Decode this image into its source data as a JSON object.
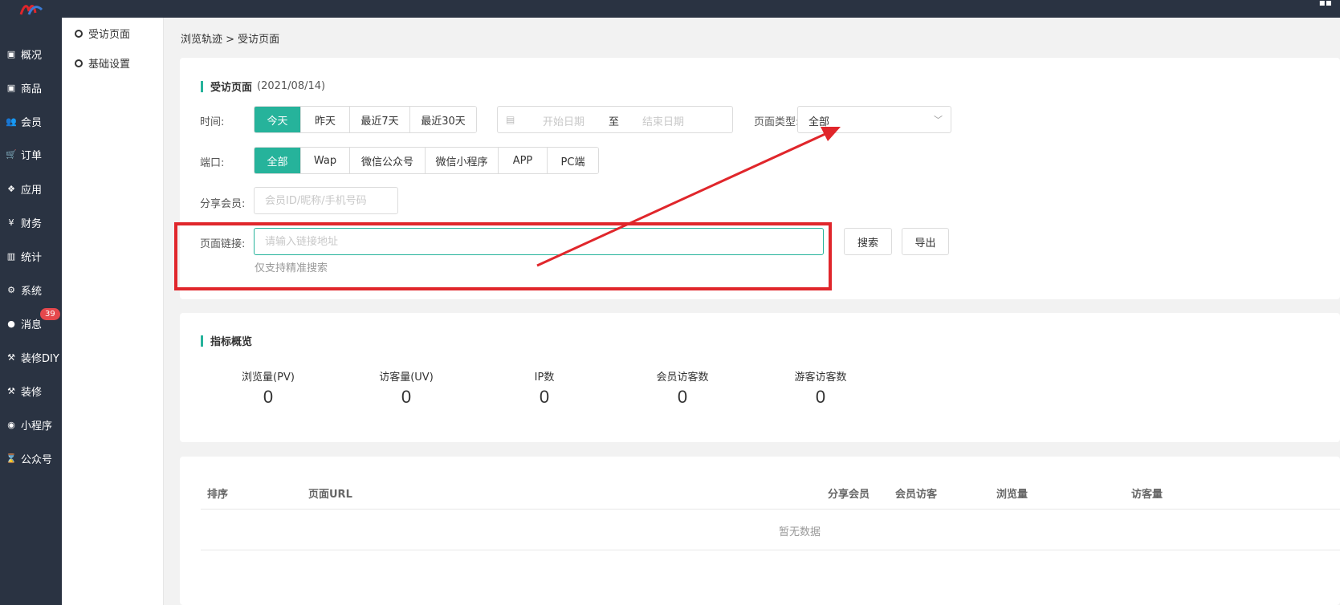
{
  "nav": {
    "items": [
      {
        "icon": "archive-icon",
        "glyph": "▣",
        "label": "概况"
      },
      {
        "icon": "archive-icon",
        "glyph": "▣",
        "label": "商品"
      },
      {
        "icon": "users-icon",
        "glyph": "👥",
        "label": "会员"
      },
      {
        "icon": "cart-icon",
        "glyph": "🛒",
        "label": "订单"
      },
      {
        "icon": "cubes-icon",
        "glyph": "❖",
        "label": "应用"
      },
      {
        "icon": "yen-icon",
        "glyph": "¥",
        "label": "财务"
      },
      {
        "icon": "bar-chart-icon",
        "glyph": "▥",
        "label": "统计"
      },
      {
        "icon": "cogs-icon",
        "glyph": "⚙",
        "label": "系统"
      },
      {
        "icon": "comment-icon",
        "glyph": "●",
        "label": "消息"
      },
      {
        "icon": "gavel-icon",
        "glyph": "⚒",
        "label": "装修DIY"
      },
      {
        "icon": "gavel-icon",
        "glyph": "⚒",
        "label": "装修"
      },
      {
        "icon": "wechat-icon",
        "glyph": "◉",
        "label": "小程序"
      },
      {
        "icon": "hourglass-icon",
        "glyph": "⌛",
        "label": "公众号"
      }
    ],
    "message_badge": "39"
  },
  "subnav": {
    "items": [
      "受访页面",
      "基础设置"
    ]
  },
  "breadcrumb": "浏览轨迹 > 受访页面",
  "filters": {
    "title": "受访页面",
    "date": "(2021/08/14)",
    "time_label": "时间:",
    "time_options": [
      "今天",
      "昨天",
      "最近7天",
      "最近30天"
    ],
    "time_selected": "今天",
    "date_start_placeholder": "开始日期",
    "date_separator": "至",
    "date_end_placeholder": "结束日期",
    "page_type_label": "页面类型:",
    "page_type_value": "全部",
    "port_label": "端口:",
    "port_options": [
      "全部",
      "Wap",
      "微信公众号",
      "微信小程序",
      "APP",
      "PC端"
    ],
    "port_selected": "全部",
    "share_member_label": "分享会员:",
    "share_member_placeholder": "会员ID/昵称/手机号码",
    "page_link_label": "页面链接:",
    "page_link_placeholder": "请输入链接地址",
    "page_link_hint": "仅支持精准搜索",
    "search_button": "搜索",
    "export_button": "导出"
  },
  "overview": {
    "title": "指标概览",
    "metrics": [
      {
        "label": "浏览量(PV)",
        "value": "0"
      },
      {
        "label": "访客量(UV)",
        "value": "0"
      },
      {
        "label": "IP数",
        "value": "0"
      },
      {
        "label": "会员访客数",
        "value": "0"
      },
      {
        "label": "游客访客数",
        "value": "0"
      }
    ]
  },
  "table": {
    "columns": [
      "排序",
      "页面URL",
      "分享会员",
      "会员访客",
      "浏览量",
      "访客量"
    ],
    "empty_text": "暂无数据"
  },
  "annotation": {
    "color": "#e0262b"
  },
  "colors": {
    "accent": "#26b39b",
    "sidebar": "#2a3342",
    "badge": "#e5484d"
  }
}
